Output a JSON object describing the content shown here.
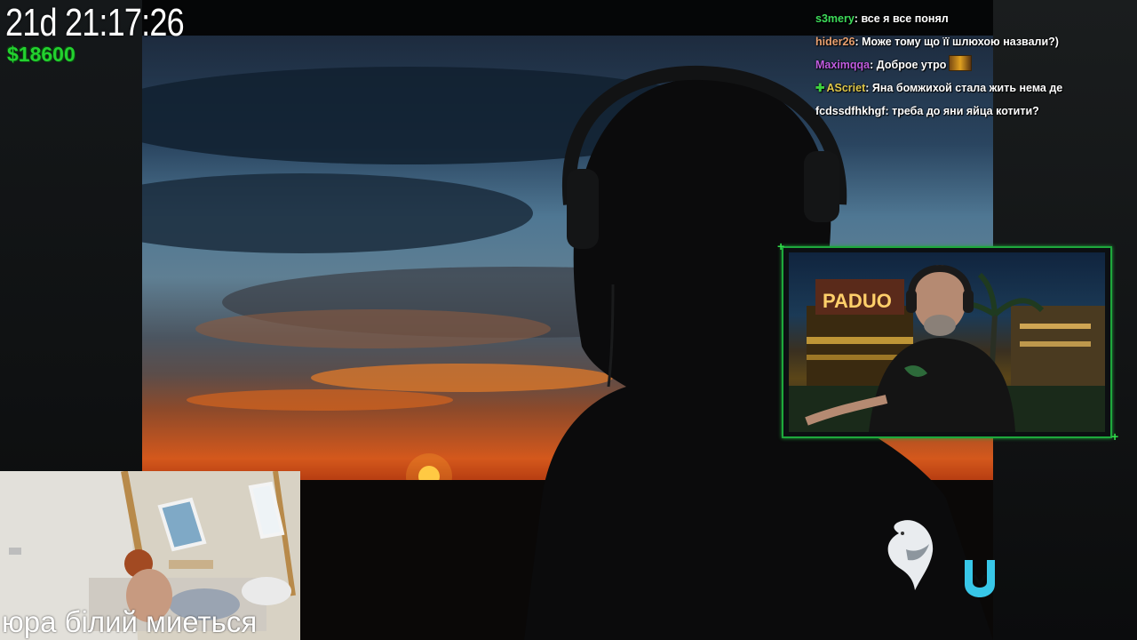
{
  "overlay": {
    "timer": "21d 21:17:26",
    "money": "$18600"
  },
  "chat": {
    "messages": [
      {
        "user": "s3mery",
        "user_color": "#3ddc5a",
        "text": "все я все понял"
      },
      {
        "user": "hider26",
        "user_color": "#e8a070",
        "text": "Може тому що її шлюхою назвали?)"
      },
      {
        "user": "Maximqqa",
        "user_color": "#c05ce0",
        "text": "Доброе утро",
        "emote": "emote-icon"
      },
      {
        "user": "AScriet",
        "user_color": "#e0c84a",
        "text": "Яна бомжихой стала жить нема де",
        "badge": "plus-icon"
      },
      {
        "user": "fcdssdfhkhgf",
        "user_color": "#ffffff",
        "text": "треба до яни яйца котити?"
      }
    ]
  },
  "inset": {
    "caption": "юра білий  миеться"
  },
  "webcam": {
    "sign_text": "PADUO",
    "accent": "#1ea83c"
  },
  "logos": {
    "left": "dolphin-icon",
    "right": "u-logo-icon"
  }
}
